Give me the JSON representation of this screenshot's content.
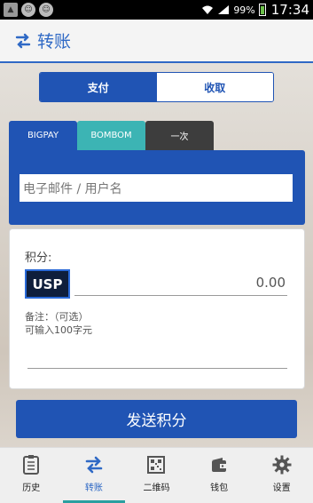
{
  "status_bar": {
    "battery": "99%",
    "time": "17:34"
  },
  "header": {
    "title": "转账"
  },
  "segment": {
    "pay": "支付",
    "receive": "收取"
  },
  "tabs": [
    {
      "label": "BIGPAY"
    },
    {
      "label": "BOMBOM"
    },
    {
      "label": "一次"
    }
  ],
  "recipient": {
    "placeholder": "电子邮件 / 用户名"
  },
  "points": {
    "label": "积分:",
    "currency": "USP",
    "amount": "0.00",
    "note_label": "备注：（可选）",
    "note_hint": "可输入100字元"
  },
  "send_button": "发送积分",
  "nav": [
    {
      "label": "历史",
      "icon": "history-icon"
    },
    {
      "label": "转账",
      "icon": "transfer-icon",
      "active": true
    },
    {
      "label": "二维码",
      "icon": "qr-code-icon"
    },
    {
      "label": "钱包",
      "icon": "wallet-icon"
    },
    {
      "label": "设置",
      "icon": "gear-icon"
    }
  ],
  "colors": {
    "primary": "#2054b4",
    "teal": "#3cb4b4",
    "dark_tab": "#3d3d3d"
  }
}
